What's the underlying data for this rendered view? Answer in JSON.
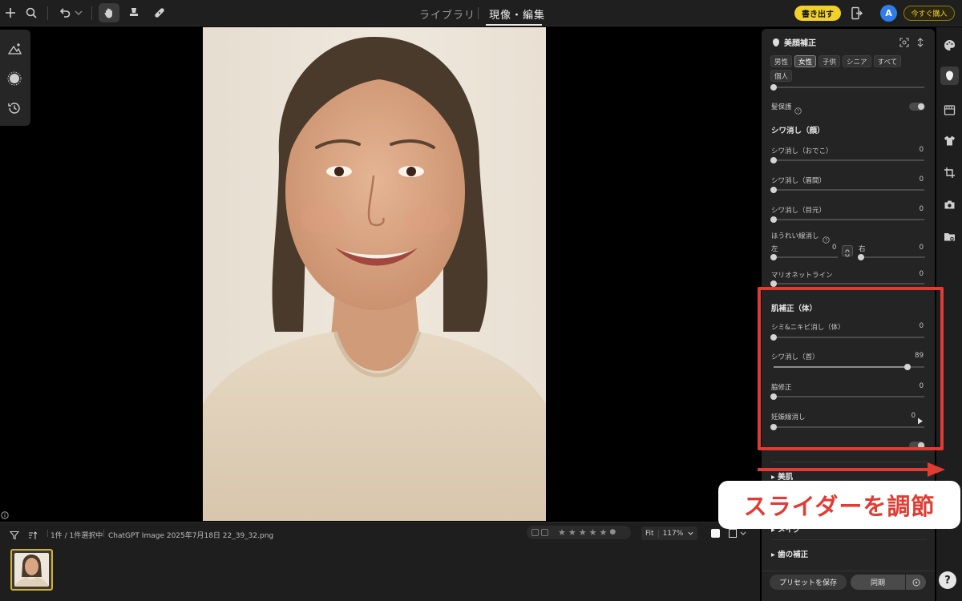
{
  "topbar": {
    "tab_library": "ライブラリ",
    "tab_develop": "現像・編集",
    "export_label": "書き出す",
    "avatar_letter": "A",
    "buy_label": "今すぐ購入"
  },
  "filmstrip": {
    "count_text": "1件 / 1件選択中",
    "filename": "ChatGPT Image 2025年7月18日 22_39_32.png",
    "zoom_fit": "Fit",
    "zoom_value": "117%",
    "stars": 5
  },
  "panel": {
    "title": "美顔補正",
    "chips": [
      "男性",
      "女性",
      "子供",
      "シニア",
      "すべて",
      "個人"
    ],
    "selected_chip": "女性",
    "hair_protect_label": "髪保護",
    "wrinkle_face_section": "シワ消し（顔）",
    "sliders_face": [
      {
        "label": "シワ消し（おでこ）",
        "value": "0"
      },
      {
        "label": "シワ消し（眉間）",
        "value": "0"
      },
      {
        "label": "シワ消し（目元）",
        "value": "0"
      }
    ],
    "nasolabial_label": "ほうれい線消し",
    "left_label": "左",
    "left_value": "0",
    "right_label": "右",
    "right_value": "0",
    "marionette_label": "マリオネットライン",
    "marionette_value": "0",
    "skin_body_section": "肌補正（体）",
    "sliders_body": [
      {
        "label": "シミ&ニキビ消し（体）",
        "value": "0",
        "fraction": 0
      },
      {
        "label": "シワ消し（首）",
        "value": "89",
        "fraction": 0.89
      },
      {
        "label": "脇修正",
        "value": "0",
        "fraction": 0
      },
      {
        "label": "妊娠線消し",
        "value": "0",
        "fraction": 0
      }
    ],
    "beauty_skin_label": "美肌",
    "makeup_label": "メイク",
    "teeth_label": "歯の補正",
    "save_preset_label": "プリセットを保存",
    "sync_label": "同期"
  },
  "annotation": {
    "callout_text": "スライダーを調節",
    "color": "#e23b33"
  },
  "colors": {
    "accent_yellow": "#f2d22a",
    "avatar_blue": "#2f7de8"
  }
}
